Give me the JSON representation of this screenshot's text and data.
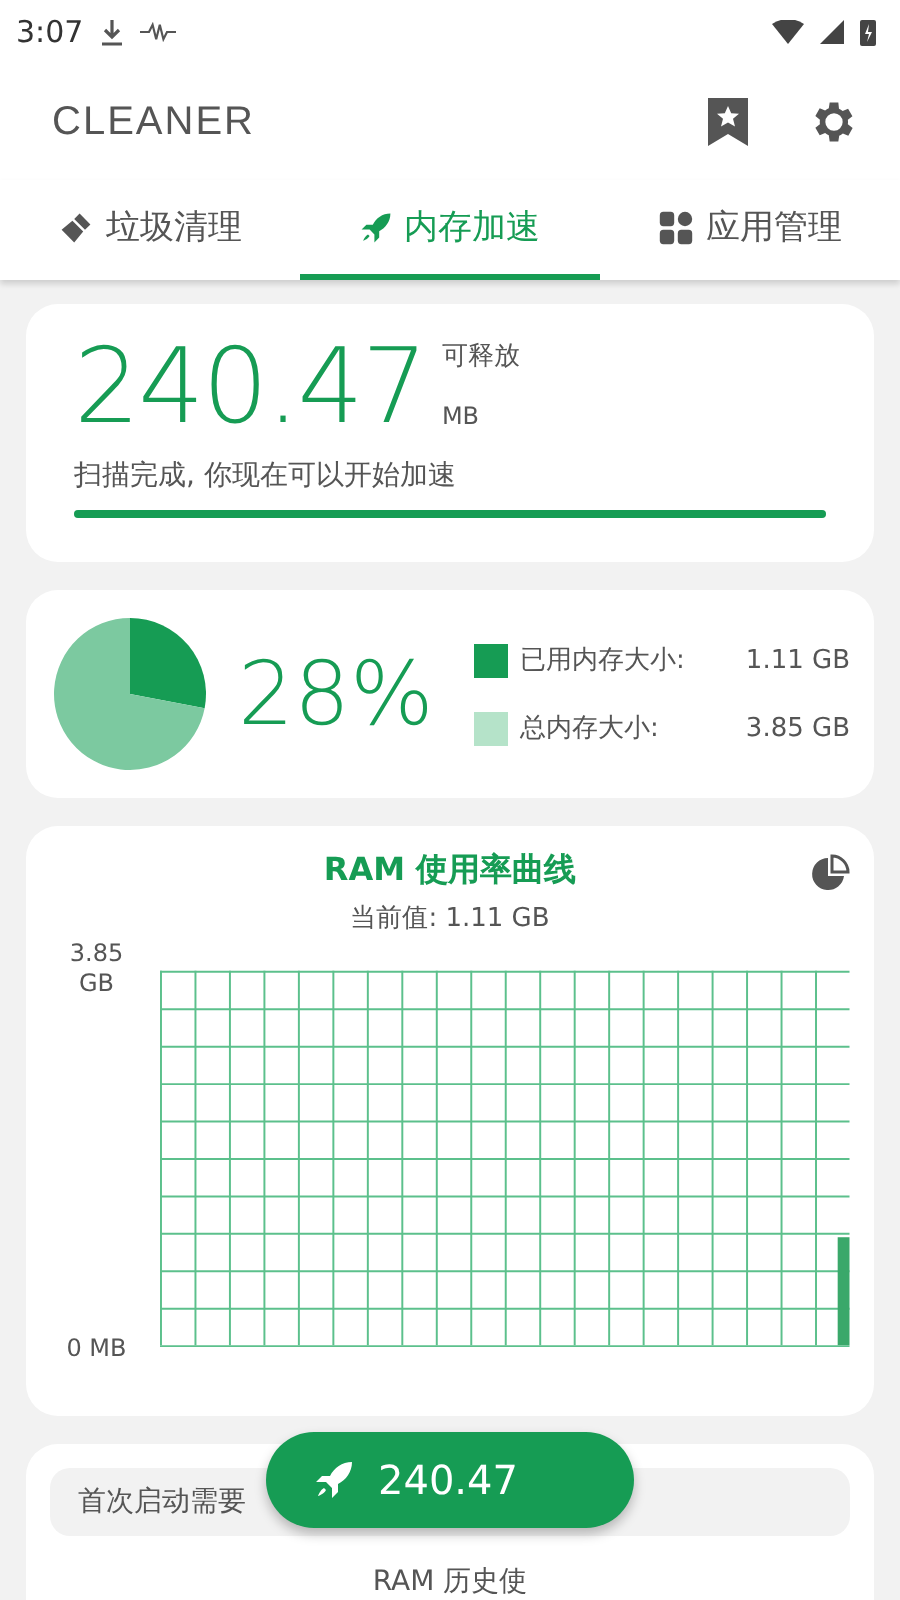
{
  "status_bar": {
    "time": "3:07"
  },
  "app_bar": {
    "title": "CLEANER"
  },
  "tabs": [
    {
      "label": "垃圾清理",
      "selected": false
    },
    {
      "label": "内存加速",
      "selected": true
    },
    {
      "label": "应用管理",
      "selected": false
    }
  ],
  "release_card": {
    "amount": "240.47",
    "caption": "可释放",
    "unit": "MB",
    "message": "扫描完成, 你现在可以开始加速",
    "progress": {
      "level": 1
    }
  },
  "memory_card": {
    "percent": "28%",
    "chart_data": {
      "type": "pie",
      "values": [
        28,
        72
      ]
    },
    "legend": [
      {
        "label": "已用内存大小:",
        "value": "1.11 GB",
        "color": "#169c54"
      },
      {
        "label": "总内存大小:",
        "value": "3.85 GB",
        "color": "#b5e3c9"
      }
    ]
  },
  "ram_card": {
    "title": "RAM 使用率曲线",
    "current": "当前值: 1.11 GB",
    "chart_data": {
      "type": "bar",
      "values": [
        null,
        null,
        null,
        null,
        null,
        null,
        null,
        null,
        null,
        null,
        null,
        null,
        null,
        null,
        null,
        null,
        null,
        null,
        null,
        1.11
      ],
      "ylim": [
        0,
        3.85
      ],
      "yticks": [
        {
          "value": 0,
          "label": "0 MB"
        },
        {
          "value": 3.85,
          "label": "3.85 GB"
        }
      ]
    }
  },
  "history_card": {
    "notice": "首次启动需要",
    "title": "RAM 历史使"
  },
  "fab": {
    "label": "240.47"
  }
}
